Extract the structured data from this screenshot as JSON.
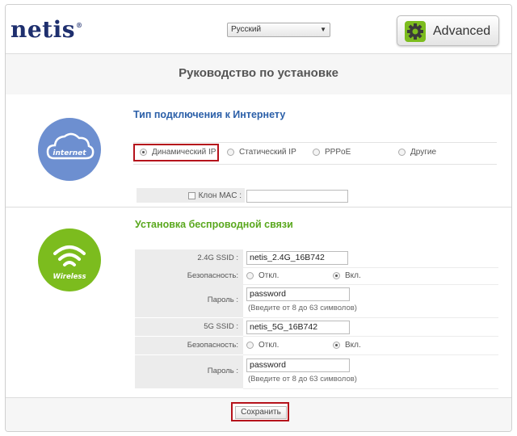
{
  "header": {
    "logo_text": "netis",
    "logo_mark": "®",
    "language": "Русский",
    "advanced_button": "Advanced"
  },
  "page": {
    "title": "Руководство по установке"
  },
  "internet": {
    "icon_label": "internet",
    "section_title": "Тип подключения к Интернету",
    "options": [
      "Динамический IP",
      "Статический IP",
      "PPPoE",
      "Другие"
    ],
    "selected_option": "Динамический IP",
    "clone_mac_label": "Клон MAC :",
    "clone_mac_checked": false,
    "clone_mac_value": ""
  },
  "wireless": {
    "icon_label": "Wireless",
    "section_title": "Установка беспроводной связи",
    "ssid24_label": "2.4G SSID :",
    "ssid24_value": "netis_2.4G_16B742",
    "security_label": "Безопасность:",
    "security_off": "Откл.",
    "security_on": "Вкл.",
    "security24_selected": "Вкл.",
    "password_label": "Пароль :",
    "password24_value": "password",
    "password_hint": "(Введите от 8 до 63 символов)",
    "ssid5_label": "5G SSID :",
    "ssid5_value": "netis_5G_16B742",
    "security5_selected": "Вкл.",
    "password5_value": "password"
  },
  "footer": {
    "save_button": "Сохранить"
  },
  "colors": {
    "logo": "#1e2f6e",
    "internet_circle": "#6d8fd0",
    "wireless_circle": "#7cbc1e",
    "internet_title": "#2b5fa8",
    "wireless_title": "#5aa81e",
    "highlight": "#b5121b"
  }
}
